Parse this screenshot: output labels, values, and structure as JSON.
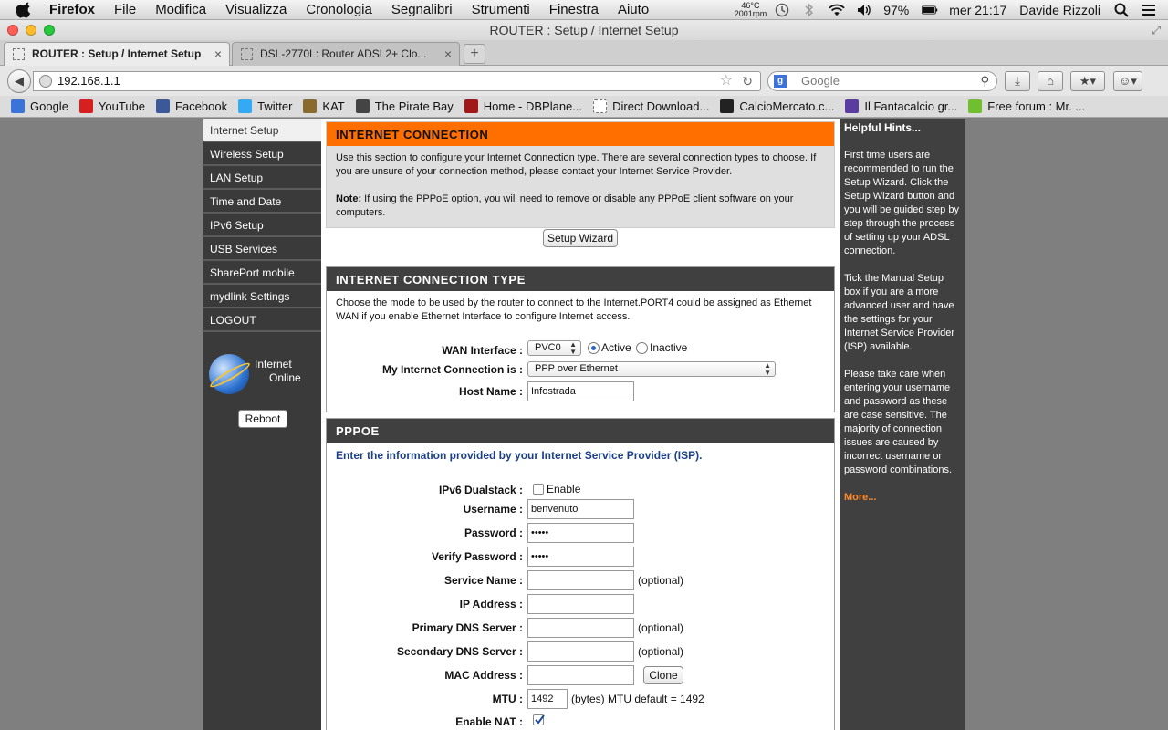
{
  "menubar": {
    "app": "Firefox",
    "items": [
      "File",
      "Modifica",
      "Visualizza",
      "Cronologia",
      "Segnalibri",
      "Strumenti",
      "Finestra",
      "Aiuto"
    ],
    "temp_line1": "46°C",
    "temp_line2": "2001rpm",
    "battery": "97%",
    "clock": "mer 21:17",
    "user": "Davide Rizzoli"
  },
  "window": {
    "title": "ROUTER : Setup / Internet Setup"
  },
  "tabs": [
    {
      "label": "ROUTER : Setup / Internet Setup"
    },
    {
      "label": "DSL-2770L: Router ADSL2+ Clo..."
    }
  ],
  "newtab_label": "+",
  "url": "192.168.1.1",
  "search_placeholder": "Google",
  "bookmarks": [
    {
      "label": "Google",
      "color": "#3b73d8"
    },
    {
      "label": "YouTube",
      "color": "#d61f1f"
    },
    {
      "label": "Facebook",
      "color": "#3b5998"
    },
    {
      "label": "Twitter",
      "color": "#33aaf3"
    },
    {
      "label": "KAT",
      "color": "#8a6b2f"
    },
    {
      "label": "The Pirate Bay",
      "color": "#444444"
    },
    {
      "label": "Home - DBPlane...",
      "color": "#a01818"
    },
    {
      "label": "Direct Download...",
      "color": "#ffffff"
    },
    {
      "label": "CalcioMercato.c...",
      "color": "#222222"
    },
    {
      "label": "Il Fantacalcio gr...",
      "color": "#5a3ca0"
    },
    {
      "label": "Free forum : Mr. ...",
      "color": "#6fbf2f"
    }
  ],
  "leftnav": {
    "items": [
      "Internet Setup",
      "Wireless Setup",
      "LAN Setup",
      "Time and Date",
      "IPv6 Setup",
      "USB Services",
      "SharePort mobile",
      "mydlink Settings",
      "LOGOUT"
    ],
    "status_line1": "Internet",
    "status_line2": "Online",
    "reboot": "Reboot"
  },
  "internet_connection": {
    "header": "INTERNET CONNECTION",
    "text": "Use this section to configure your Internet Connection type. There are several connection types to choose. If you are unsure of your connection method, please contact your Internet Service Provider.",
    "note_label": "Note:",
    "note_text": " If using the PPPoE option, you will need to remove or disable any PPPoE client software on your computers.",
    "setup_wizard": "Setup Wizard"
  },
  "connection_type": {
    "header": "INTERNET CONNECTION TYPE",
    "text": "Choose the mode to be used by the router to connect to the Internet.PORT4 could be assigned as Ethernet WAN if you enable Ethernet Interface to configure Internet access.",
    "wan_label": "WAN Interface :",
    "wan_value": "PVC0",
    "active_label": "Active",
    "inactive_label": "Inactive",
    "myconn_label": "My Internet Connection is :",
    "myconn_value": "PPP over Ethernet",
    "host_label": "Host Name :",
    "host_value": "Infostrada"
  },
  "pppoe": {
    "header": "PPPOE",
    "intro": "Enter the information provided by your Internet Service Provider (ISP).",
    "ipv6_label": "IPv6 Dualstack :",
    "ipv6_enable": "Enable",
    "username_label": "Username :",
    "username_value": "benvenuto",
    "password_label": "Password :",
    "password_value": "•••••",
    "verify_label": "Verify Password :",
    "verify_value": "•••••",
    "service_label": "Service Name :",
    "ip_label": "IP Address :",
    "pdns_label": "Primary DNS Server :",
    "sdns_label": "Secondary DNS Server :",
    "mac_label": "MAC Address :",
    "clone": "Clone",
    "optional": "(optional)",
    "mtu_label": "MTU :",
    "mtu_value": "1492",
    "mtu_note": "(bytes) MTU default = 1492",
    "nat_label": "Enable NAT :"
  },
  "hints": {
    "title": "Helpful Hints...",
    "p1": "First time users are recommended to run the Setup Wizard. Click the Setup Wizard button and you will be guided step by step through the process of setting up your ADSL connection.",
    "p2": "Tick the Manual Setup box if you are a more advanced user and have the settings for your Internet Service Provider (ISP) available.",
    "p3": "Please take care when entering your username and password as these are case sensitive. The majority of connection issues are caused by incorrect username or password combinations.",
    "more": "More..."
  }
}
